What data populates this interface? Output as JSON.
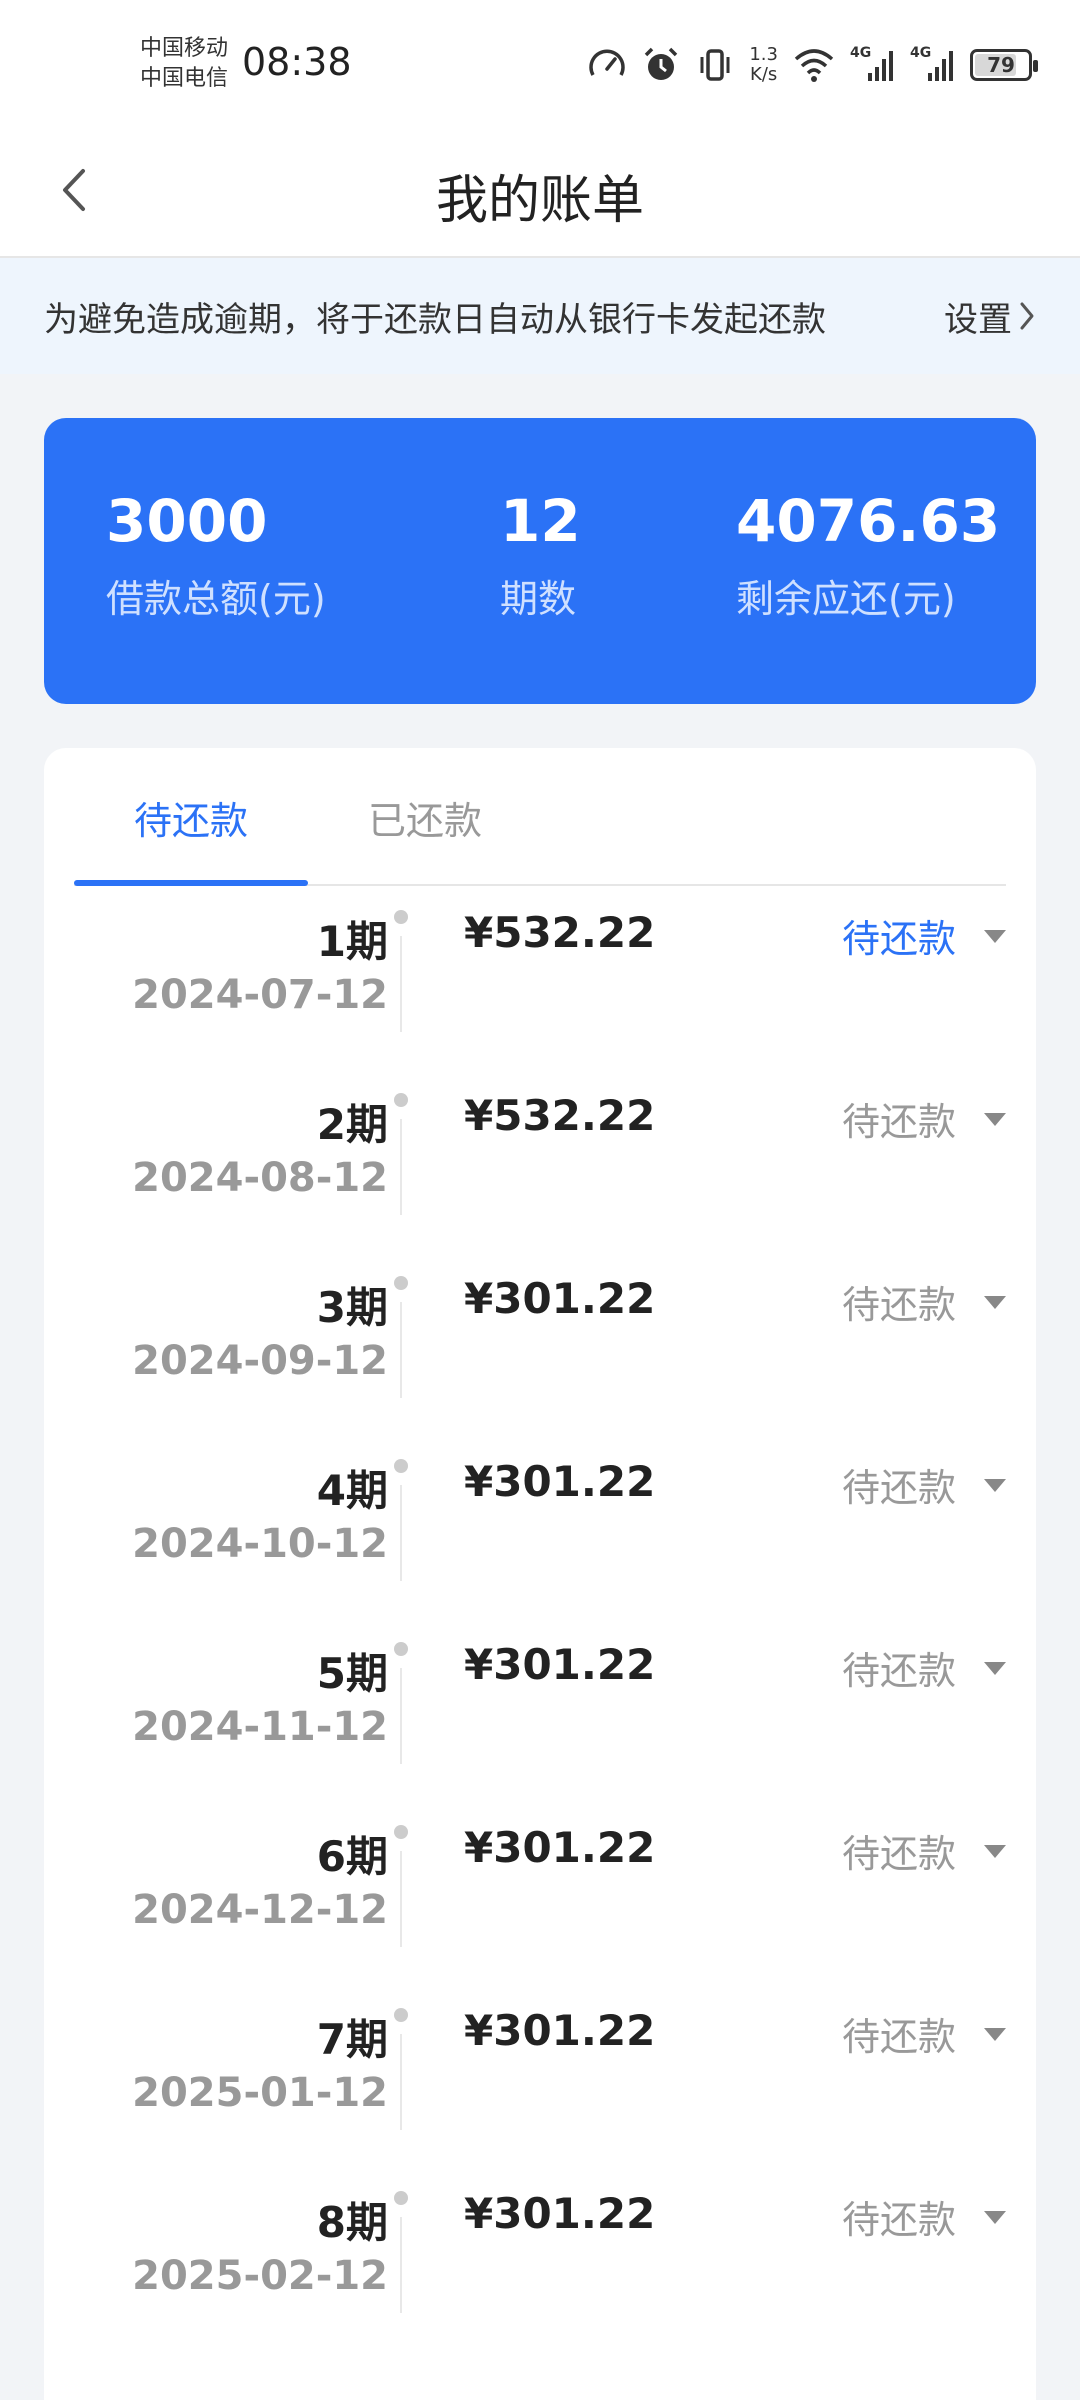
{
  "status_bar": {
    "carrier1": "中国移动",
    "carrier2": "中国电信",
    "time": "08:38",
    "speed_value": "1.3",
    "speed_unit": "K/s",
    "signal1_label": "4G",
    "signal2_label": "4G",
    "battery": "79",
    "battery_level": 0.79
  },
  "header": {
    "title": "我的账单"
  },
  "notice": {
    "text": "为避免造成逾期，将于还款日自动从银行卡发起还款",
    "link": "设置"
  },
  "summary": {
    "total_amount": {
      "value": "3000",
      "label": "借款总额(元)"
    },
    "periods": {
      "value": "12",
      "label": "期数"
    },
    "remaining": {
      "value": "4076.63",
      "label": "剩余应还(元)"
    }
  },
  "tabs": [
    {
      "label": "待还款",
      "active": true
    },
    {
      "label": "已还款",
      "active": false
    }
  ],
  "bills": [
    {
      "period": "1期",
      "date": "2024-07-12",
      "amount": "¥532.22",
      "status": "待还款",
      "active": true
    },
    {
      "period": "2期",
      "date": "2024-08-12",
      "amount": "¥532.22",
      "status": "待还款",
      "active": false
    },
    {
      "period": "3期",
      "date": "2024-09-12",
      "amount": "¥301.22",
      "status": "待还款",
      "active": false
    },
    {
      "period": "4期",
      "date": "2024-10-12",
      "amount": "¥301.22",
      "status": "待还款",
      "active": false
    },
    {
      "period": "5期",
      "date": "2024-11-12",
      "amount": "¥301.22",
      "status": "待还款",
      "active": false
    },
    {
      "period": "6期",
      "date": "2024-12-12",
      "amount": "¥301.22",
      "status": "待还款",
      "active": false
    },
    {
      "period": "7期",
      "date": "2025-01-12",
      "amount": "¥301.22",
      "status": "待还款",
      "active": false
    },
    {
      "period": "8期",
      "date": "2025-02-12",
      "amount": "¥301.22",
      "status": "待还款",
      "active": false
    }
  ],
  "colors": {
    "accent": "#2b72f6",
    "muted": "#999999",
    "background": "#f2f4f7"
  }
}
